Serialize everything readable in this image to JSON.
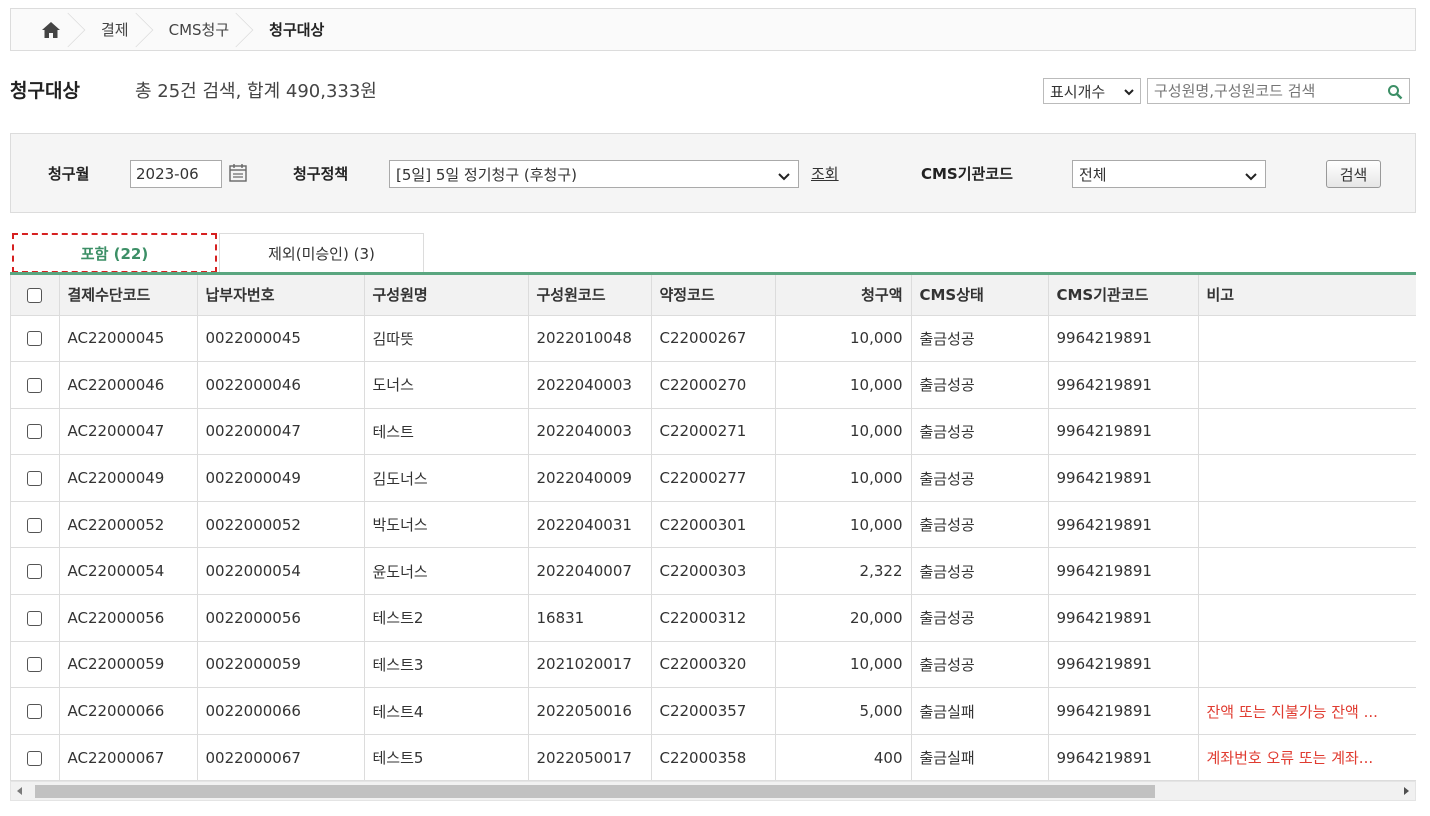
{
  "breadcrumb": {
    "items": [
      "결제",
      "CMS청구",
      "청구대상"
    ]
  },
  "header": {
    "title": "청구대상",
    "summary": "총 25건 검색, 합계 490,333원",
    "display_select": "표시개수",
    "search_placeholder": "구성원명,구성원코드 검색"
  },
  "filters": {
    "month_label": "청구월",
    "month_value": "2023-06",
    "policy_label": "청구정책",
    "policy_value": "[5일] 5일 정기청구 (후청구)",
    "lookup_label": "조회",
    "cms_label": "CMS기관코드",
    "cms_value": "전체",
    "search_button": "검색"
  },
  "tabs": [
    {
      "label": "포함 (22)",
      "active": true
    },
    {
      "label": "제외(미승인) (3)",
      "active": false
    }
  ],
  "table": {
    "columns": [
      "결제수단코드",
      "납부자번호",
      "구성원명",
      "구성원코드",
      "약정코드",
      "청구액",
      "CMS상태",
      "CMS기관코드",
      "비고"
    ],
    "rows": [
      {
        "code": "AC22000045",
        "payer": "0022000045",
        "name": "김따뜻",
        "member": "2022010048",
        "contract": "C22000267",
        "amount": "10,000",
        "status": "출금성공",
        "cms": "9964219891",
        "note": ""
      },
      {
        "code": "AC22000046",
        "payer": "0022000046",
        "name": "도너스",
        "member": "2022040003",
        "contract": "C22000270",
        "amount": "10,000",
        "status": "출금성공",
        "cms": "9964219891",
        "note": ""
      },
      {
        "code": "AC22000047",
        "payer": "0022000047",
        "name": "테스트",
        "member": "2022040003",
        "contract": "C22000271",
        "amount": "10,000",
        "status": "출금성공",
        "cms": "9964219891",
        "note": ""
      },
      {
        "code": "AC22000049",
        "payer": "0022000049",
        "name": "김도너스",
        "member": "2022040009",
        "contract": "C22000277",
        "amount": "10,000",
        "status": "출금성공",
        "cms": "9964219891",
        "note": ""
      },
      {
        "code": "AC22000052",
        "payer": "0022000052",
        "name": "박도너스",
        "member": "2022040031",
        "contract": "C22000301",
        "amount": "10,000",
        "status": "출금성공",
        "cms": "9964219891",
        "note": ""
      },
      {
        "code": "AC22000054",
        "payer": "0022000054",
        "name": "윤도너스",
        "member": "2022040007",
        "contract": "C22000303",
        "amount": "2,322",
        "status": "출금성공",
        "cms": "9964219891",
        "note": ""
      },
      {
        "code": "AC22000056",
        "payer": "0022000056",
        "name": "테스트2",
        "member": "16831",
        "contract": "C22000312",
        "amount": "20,000",
        "status": "출금성공",
        "cms": "9964219891",
        "note": ""
      },
      {
        "code": "AC22000059",
        "payer": "0022000059",
        "name": "테스트3",
        "member": "2021020017",
        "contract": "C22000320",
        "amount": "10,000",
        "status": "출금성공",
        "cms": "9964219891",
        "note": ""
      },
      {
        "code": "AC22000066",
        "payer": "0022000066",
        "name": "테스트4",
        "member": "2022050016",
        "contract": "C22000357",
        "amount": "5,000",
        "status": "출금실패",
        "cms": "9964219891",
        "note": "잔액 또는 지불가능 잔액 ..."
      },
      {
        "code": "AC22000067",
        "payer": "0022000067",
        "name": "테스트5",
        "member": "2022050017",
        "contract": "C22000358",
        "amount": "400",
        "status": "출금실패",
        "cms": "9964219891",
        "note": "계좌번호 오류 또는 계좌..."
      }
    ]
  },
  "colors": {
    "accent_green": "#3c8f66",
    "tab_line": "#5aa680",
    "warn_red": "#e03c31",
    "highlight_dashed": "#d62020"
  }
}
